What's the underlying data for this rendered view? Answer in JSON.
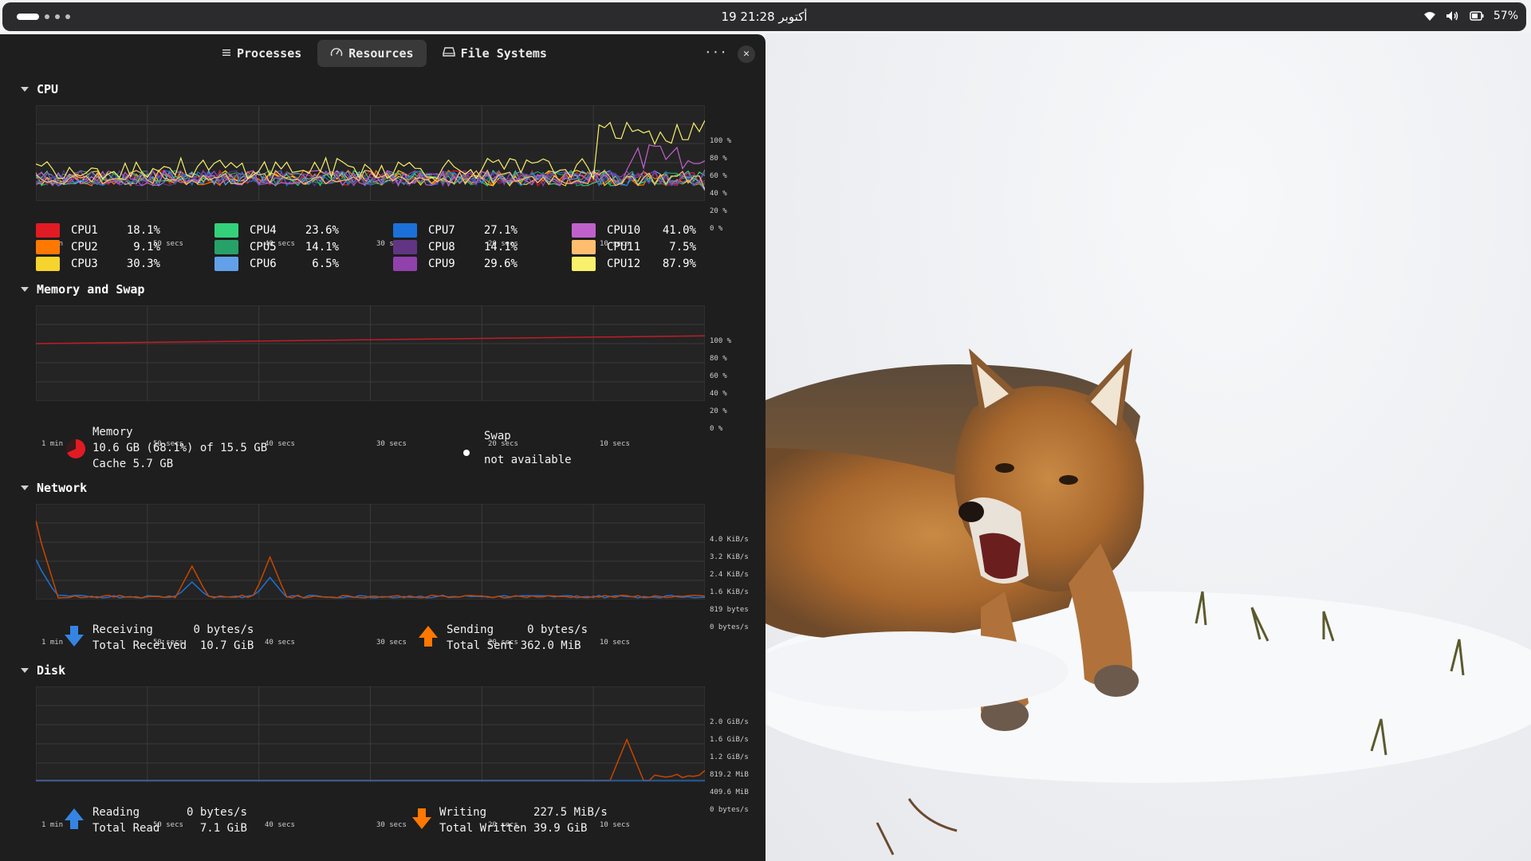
{
  "topbar": {
    "clock": "19 أكتوبر 21:28",
    "battery": "57%"
  },
  "tabs": [
    {
      "label": "Processes",
      "icon": "list-icon"
    },
    {
      "label": "Resources",
      "icon": "gauge-icon"
    },
    {
      "label": "File Systems",
      "icon": "drive-icon"
    }
  ],
  "x_ticks": [
    "1 min",
    "50 secs",
    "40 secs",
    "30 secs",
    "20 secs",
    "10 secs"
  ],
  "cpu": {
    "title": "CPU",
    "y_ticks": [
      "100 %",
      "80 %",
      "60 %",
      "40 %",
      "20 %",
      "0 %"
    ],
    "cores": [
      {
        "name": "CPU1",
        "value": "18.1%",
        "color": "#e01b24"
      },
      {
        "name": "CPU2",
        "value": "9.1%",
        "color": "#ff7800"
      },
      {
        "name": "CPU3",
        "value": "30.3%",
        "color": "#f6d32d"
      },
      {
        "name": "CPU4",
        "value": "23.6%",
        "color": "#33d17a"
      },
      {
        "name": "CPU5",
        "value": "14.1%",
        "color": "#26a269"
      },
      {
        "name": "CPU6",
        "value": "6.5%",
        "color": "#62a0ea"
      },
      {
        "name": "CPU7",
        "value": "27.1%",
        "color": "#1c71d8"
      },
      {
        "name": "CPU8",
        "value": "14.1%",
        "color": "#613583"
      },
      {
        "name": "CPU9",
        "value": "29.6%",
        "color": "#9141ac"
      },
      {
        "name": "CPU10",
        "value": "41.0%",
        "color": "#c061cb"
      },
      {
        "name": "CPU11",
        "value": "7.5%",
        "color": "#ffbe6f"
      },
      {
        "name": "CPU12",
        "value": "87.9%",
        "color": "#f9f06b"
      }
    ]
  },
  "memory": {
    "title": "Memory and Swap",
    "y_ticks": [
      "100 %",
      "80 %",
      "60 %",
      "40 %",
      "20 %",
      "0 %"
    ],
    "mem_label": "Memory",
    "mem_usage": "10.6 GB (68.1%) of 15.5 GB",
    "mem_cache": "Cache 5.7 GB",
    "mem_fraction": 0.681,
    "swap_label": "Swap",
    "swap_status": "not available"
  },
  "network": {
    "title": "Network",
    "y_ticks": [
      "4.0 KiB/s",
      "3.2 KiB/s",
      "2.4 KiB/s",
      "1.6 KiB/s",
      "819 bytes",
      "0 bytes/s"
    ],
    "recv_label": "Receiving",
    "recv_value": "0 bytes/s",
    "total_recv_label": "Total Received",
    "total_recv_value": "10.7 GiB",
    "send_label": "Sending",
    "send_value": "0 bytes/s",
    "total_sent_label": "Total Sent",
    "total_sent_value": "362.0 MiB"
  },
  "disk": {
    "title": "Disk",
    "y_ticks": [
      "2.0 GiB/s",
      "1.6 GiB/s",
      "1.2 GiB/s",
      "819.2 MiB",
      "409.6 MiB",
      "0 bytes/s"
    ],
    "read_label": "Reading",
    "read_value": "0 bytes/s",
    "total_read_label": "Total Read",
    "total_read_value": "7.1 GiB",
    "write_label": "Writing",
    "write_value": "227.5 MiB/s",
    "total_written_label": "Total Written",
    "total_written_value": "39.9 GiB"
  }
}
